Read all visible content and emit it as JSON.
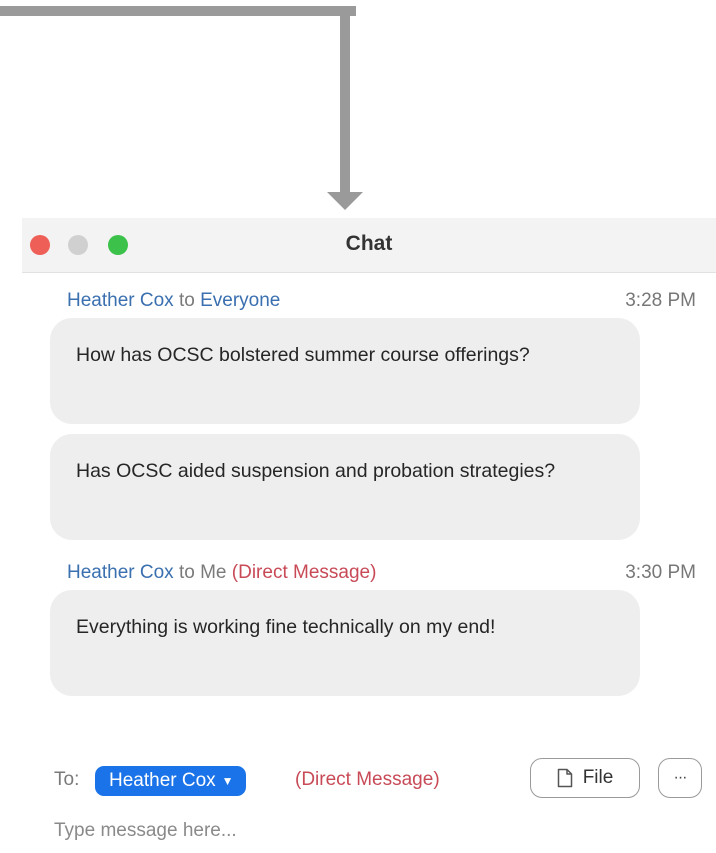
{
  "window": {
    "title": "Chat"
  },
  "messages": [
    {
      "sender": "Heather Cox",
      "to_word": "to",
      "recipient": "Everyone",
      "direct_tag": "",
      "time": "3:28 PM",
      "bubbles": [
        "How has OCSC bolstered summer course offerings?",
        "Has OCSC aided suspension and probation strategies?"
      ]
    },
    {
      "sender": "Heather Cox",
      "to_word": "to",
      "recipient": "Me",
      "direct_tag": "(Direct Message)",
      "time": "3:30 PM",
      "bubbles": [
        "Everything is working fine technically on my end!"
      ]
    }
  ],
  "footer": {
    "to_label": "To:",
    "recipient": "Heather Cox",
    "direct_tag": "(Direct Message)",
    "file_label": "File",
    "more_label": "···",
    "input_placeholder": "Type message here..."
  },
  "colors": {
    "sender": "#3a6fb0",
    "direct_message": "#c84a57",
    "chip": "#1a73e8",
    "bubble": "#eeeeef",
    "traffic_red": "#ee5f57",
    "traffic_green": "#3cc14a"
  },
  "icons": [
    "close-dot",
    "minimize-dot",
    "maximize-dot",
    "caret-down-icon",
    "file-icon",
    "more-icon"
  ]
}
